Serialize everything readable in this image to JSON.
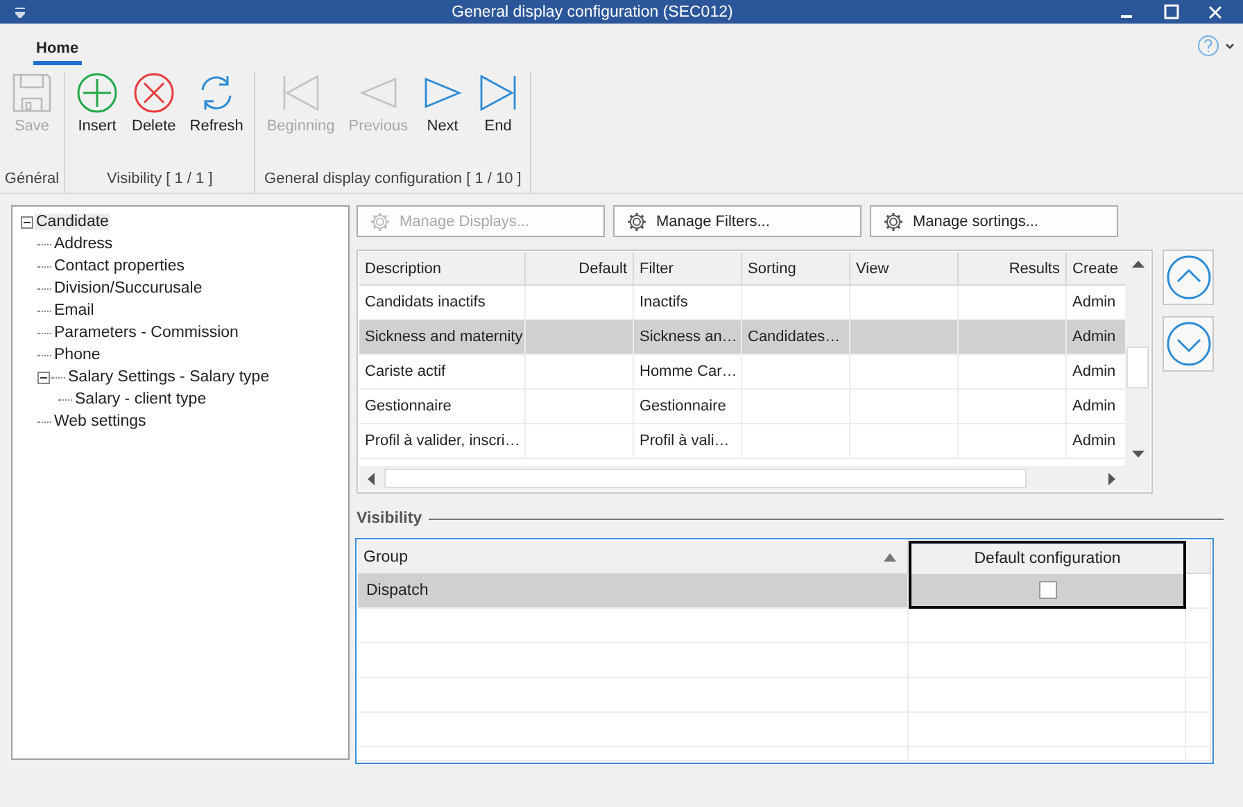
{
  "window": {
    "title": "General display configuration (SEC012)"
  },
  "tabs": [
    {
      "label": "Home",
      "selected": true
    }
  ],
  "ribbon_groups": [
    {
      "label": "Général",
      "buttons": [
        {
          "label": "Save",
          "kind": "save",
          "disabled": true
        }
      ]
    },
    {
      "label": "Visibility [ 1 / 1 ]",
      "buttons": [
        {
          "label": "Insert",
          "kind": "insert",
          "disabled": false
        },
        {
          "label": "Delete",
          "kind": "delete",
          "disabled": false
        },
        {
          "label": "Refresh",
          "kind": "refresh",
          "disabled": false
        }
      ]
    },
    {
      "label": "General display configuration [ 1 / 10 ]",
      "buttons": [
        {
          "label": "Beginning",
          "kind": "first",
          "disabled": true
        },
        {
          "label": "Previous",
          "kind": "prev",
          "disabled": true
        },
        {
          "label": "Next",
          "kind": "next",
          "disabled": false
        },
        {
          "label": "End",
          "kind": "last",
          "disabled": false
        }
      ]
    }
  ],
  "tree": [
    {
      "label": "Candidate",
      "expanded": true,
      "selected": true,
      "children": [
        {
          "label": "Address"
        },
        {
          "label": "Contact properties"
        },
        {
          "label": "Division/Succurusale"
        },
        {
          "label": "Email"
        },
        {
          "label": "Parameters - Commission"
        },
        {
          "label": "Phone"
        },
        {
          "label": "Salary Settings - Salary type",
          "expanded": true,
          "selected": false,
          "children": [
            {
              "label": "Salary - client type"
            }
          ]
        },
        {
          "label": "Web settings"
        }
      ]
    }
  ],
  "manage_buttons": [
    {
      "label": "Manage Displays...",
      "disabled": true
    },
    {
      "label": "Manage Filters...",
      "disabled": false
    },
    {
      "label": "Manage sortings...",
      "disabled": false
    }
  ],
  "table": {
    "columns": [
      "Description",
      "Default",
      "Filter",
      "Sorting",
      "View",
      "Results",
      "Create"
    ],
    "rows": [
      {
        "selected": false,
        "cells": [
          "Candidats inactifs",
          "",
          "Inactifs",
          "",
          "",
          "",
          "Admin"
        ]
      },
      {
        "selected": true,
        "cells": [
          "Sickness and maternity",
          "",
          "Sickness an…",
          "Candidates…",
          "",
          "",
          "Admin"
        ]
      },
      {
        "selected": false,
        "cells": [
          "Cariste actif",
          "",
          "Homme Car…",
          "",
          "",
          "",
          "Admin"
        ]
      },
      {
        "selected": false,
        "cells": [
          "Gestionnaire",
          "",
          "Gestionnaire",
          "",
          "",
          "",
          "Admin"
        ]
      },
      {
        "selected": false,
        "cells": [
          "Profil à valider, inscri…",
          "",
          "Profil à vali…",
          "",
          "",
          "",
          "Admin"
        ]
      }
    ]
  },
  "visibility": {
    "title": "Visibility",
    "columns": [
      "Group",
      "Default configuration"
    ],
    "rows": [
      {
        "group": "Dispatch",
        "checked": false,
        "selected": true
      }
    ]
  }
}
